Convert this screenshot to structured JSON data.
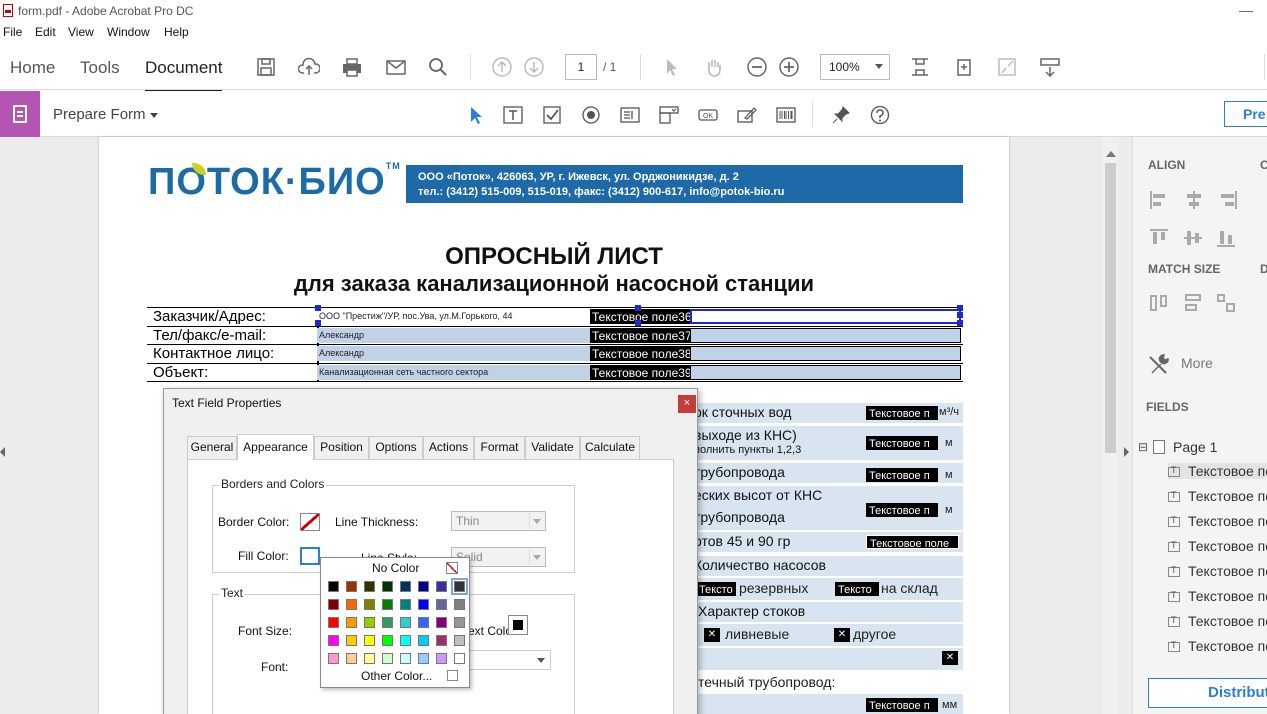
{
  "window": {
    "title": "form.pdf - Adobe Acrobat Pro DC",
    "minimize": "—"
  },
  "menu": [
    "File",
    "Edit",
    "View",
    "Window",
    "Help"
  ],
  "nav_tabs": [
    "Home",
    "Tools",
    "Document"
  ],
  "toolbar": {
    "page_current": "1",
    "page_total": "/ 1",
    "zoom": "100%"
  },
  "prepare": {
    "title": "Prepare Form",
    "preview_label": "Pre"
  },
  "pdf": {
    "logo": "ПОТОК·БИО",
    "logo_tm": "TM",
    "header_line1": "ООО «Поток»,  426063, УР, г. Ижевск, ул. Орджоникидзе, д. 2",
    "header_line2": "тел.: (3412) 515-009, 515-019, факс: (3412) 900-617, info@potok-bio.ru",
    "heading1": "ОПРОСНЫЙ ЛИСТ",
    "heading2": "для заказа канализационной насосной станции",
    "rows": [
      {
        "label": "Заказчик/Адрес:",
        "value": "ООО \"Престиж\"/УР, пос.Ува, ул.М.Горького, 44",
        "field": "Текстовое поле36"
      },
      {
        "label": "Тел/факс/e-mail:",
        "value": "Александр",
        "field": "Текстовое поле37"
      },
      {
        "label": "Контактное лицо:",
        "value": "Александр",
        "field": "Текстовое поле38"
      },
      {
        "label": "Объект:",
        "value": "Канализационная сеть частного сектора",
        "field": "Текстовое поле39"
      }
    ],
    "right_lines": {
      "flow": "ок сточных вод",
      "flow_field": "Текстовое п",
      "flow_unit": "м³/ч",
      "outlet": "выходе из КНС)",
      "outlet_sub": "полнить пункты 1,2,3",
      "outlet_field": "Текстовое п",
      "outlet_unit": "м",
      "pipe": "трубопровода",
      "pipe_field": "Текстовое п",
      "pipe_unit": "м",
      "heights": "еских высот от КНС",
      "pipe2": "трубопровода",
      "pipe2_field": "Текстовое п",
      "pipe2_unit": "м",
      "turns": "отов 45 и 90 гр",
      "turns_field": "Текстовое поле",
      "pumps": "Количество насосов",
      "reserve_field": "Тексто",
      "reserve": "резервных",
      "stock_field": "Тексто",
      "stock": "на склад",
      "character": "Характер стоков",
      "chk_symbol": "✕",
      "storm": "ливневые",
      "other": "другое",
      "pressure": "течный трубопровод:",
      "pressure_field": "Текстовое п",
      "pressure_unit": "мм"
    }
  },
  "dialog": {
    "title": "Text Field Properties",
    "close": "×",
    "tabs": [
      "General",
      "Appearance",
      "Position",
      "Options",
      "Actions",
      "Format",
      "Validate",
      "Calculate"
    ],
    "active_tab": "Appearance",
    "borders_group": "Borders and Colors",
    "border_color_label": "Border Color:",
    "fill_color_label": "Fill Color:",
    "line_thickness_label": "Line Thickness:",
    "line_thickness_value": "Thin",
    "line_style_label": "Line Style:",
    "line_style_value": "Solid",
    "text_group": "Text",
    "font_size_label": "Font Size:",
    "text_color_label": "ext Color:",
    "font_label": "Font:"
  },
  "color_picker": {
    "no_color": "No Color",
    "other_color": "Other Color...",
    "grid": [
      [
        "#000000",
        "#993300",
        "#333300",
        "#003300",
        "#003366",
        "#000080",
        "#333399",
        "#333333"
      ],
      [
        "#800000",
        "#ff6600",
        "#808000",
        "#008000",
        "#008080",
        "#0000ff",
        "#666699",
        "#808080"
      ],
      [
        "#ff0000",
        "#ff9900",
        "#99cc00",
        "#339966",
        "#33cccc",
        "#3366ff",
        "#800080",
        "#969696"
      ],
      [
        "#ff00ff",
        "#ffcc00",
        "#ffff00",
        "#00ff00",
        "#00ffff",
        "#00ccff",
        "#993366",
        "#c0c0c0"
      ],
      [
        "#ff99cc",
        "#ffcc99",
        "#ffff99",
        "#ccffcc",
        "#ccffff",
        "#99ccff",
        "#cc99ff",
        "#ffffff"
      ]
    ]
  },
  "right_panel": {
    "align": "ALIGN",
    "align_c": "C",
    "match_size": "MATCH SIZE",
    "match_d": "D",
    "more": "More",
    "fields": "FIELDS",
    "tree_toggle": "⊟",
    "page_node": "Page 1",
    "items": [
      "Текстовое по",
      "Текстовое по",
      "Текстовое по",
      "Текстовое по",
      "Текстовое по",
      "Текстовое по",
      "Текстовое по",
      "Текстовое по"
    ],
    "distribute": "Distribut"
  },
  "colors": {
    "accent": "#2d7fd3",
    "prepare_purple": "#b455b3",
    "brand_blue": "#1e6aa8",
    "field_fill": "#bfd2e6"
  }
}
